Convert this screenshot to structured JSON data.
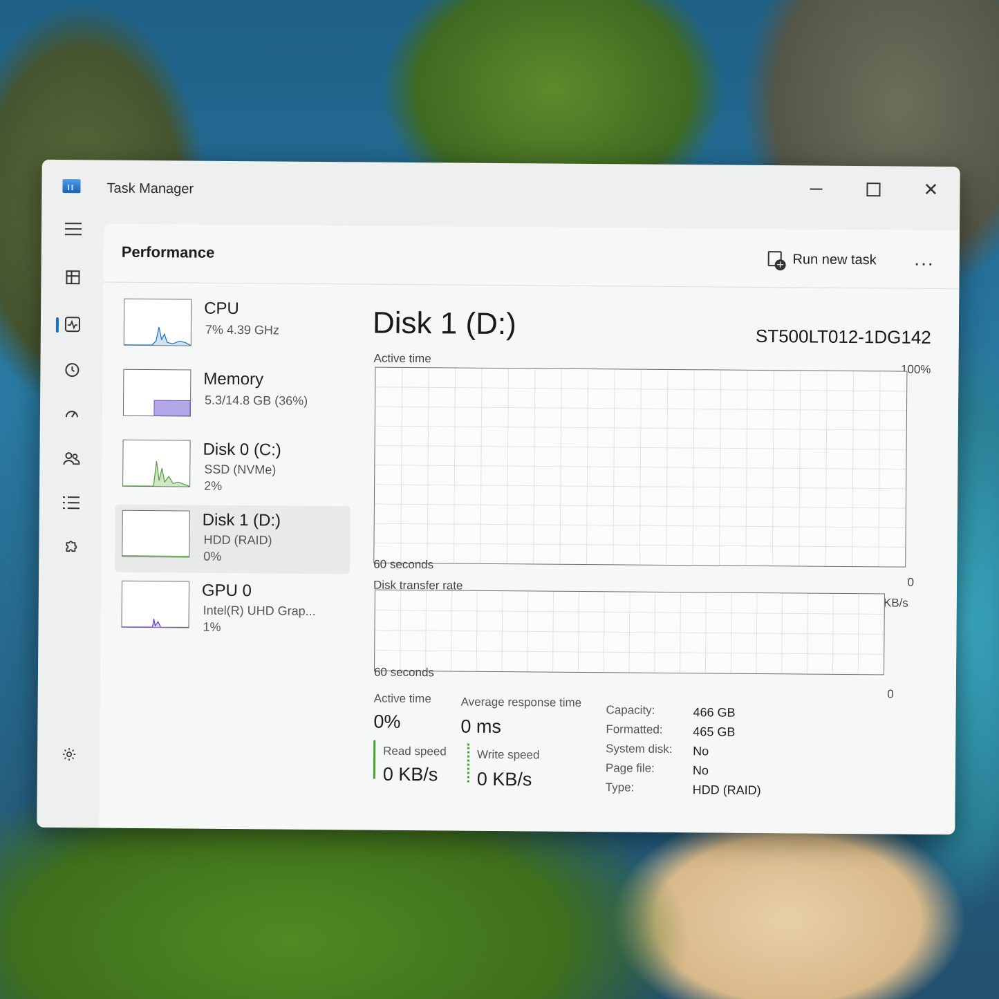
{
  "window": {
    "title": "Task Manager"
  },
  "header": {
    "title": "Performance",
    "run_task_label": "Run new task",
    "more_label": "..."
  },
  "devices": [
    {
      "name": "CPU",
      "line1": "7% 4.39 GHz",
      "line2": "",
      "graph_color": "#1a6fb5"
    },
    {
      "name": "Memory",
      "line1": "5.3/14.8 GB (36%)",
      "line2": "",
      "graph_color": "#7b4fc9"
    },
    {
      "name": "Disk 0 (C:)",
      "line1": "SSD (NVMe)",
      "line2": "2%",
      "graph_color": "#4f9b3a"
    },
    {
      "name": "Disk 1 (D:)",
      "line1": "HDD (RAID)",
      "line2": "0%",
      "graph_color": "#4f9b3a"
    },
    {
      "name": "GPU 0",
      "line1": "Intel(R) UHD Grap...",
      "line2": "1%",
      "graph_color": "#6a3fc7"
    }
  ],
  "detail": {
    "title": "Disk 1 (D:)",
    "model": "ST500LT012-1DG142",
    "active_graph": {
      "label": "Active time",
      "max": "100%",
      "min": "0",
      "time": "60 seconds"
    },
    "transfer_graph": {
      "label": "Disk transfer rate",
      "max": "100 KB/s",
      "min": "0",
      "time": "60 seconds"
    },
    "stats": {
      "active_time_label": "Active time",
      "active_time_value": "0%",
      "avg_response_label": "Average response time",
      "avg_response_value": "0 ms",
      "read_label": "Read speed",
      "read_value": "0 KB/s",
      "write_label": "Write speed",
      "write_value": "0 KB/s"
    },
    "specs": [
      {
        "label": "Capacity:",
        "value": "466 GB"
      },
      {
        "label": "Formatted:",
        "value": "465 GB"
      },
      {
        "label": "System disk:",
        "value": "No"
      },
      {
        "label": "Page file:",
        "value": "No"
      },
      {
        "label": "Type:",
        "value": "HDD (RAID)"
      }
    ]
  },
  "icons": {
    "minimize": "minimize-icon",
    "maximize": "maximize-icon",
    "close": "close-icon",
    "menu": "hamburger-icon",
    "settings": "gear-icon"
  }
}
